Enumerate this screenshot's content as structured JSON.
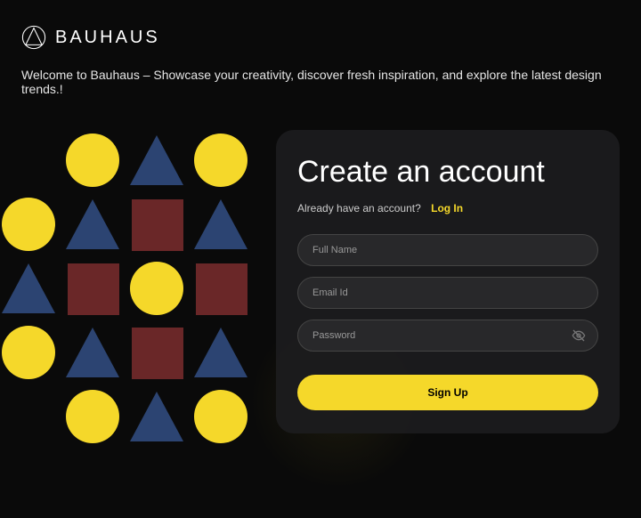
{
  "brand": "BAUHAUS",
  "welcome": "Welcome to Bauhaus – Showcase your creativity, discover fresh inspiration, and explore the latest design trends.!",
  "card": {
    "title": "Create an account",
    "subtitle": "Already have an account?",
    "login_link": "Log In",
    "fields": {
      "fullname_placeholder": "Full Name",
      "email_placeholder": "Email Id",
      "password_placeholder": "Password"
    },
    "signup_label": "Sign Up"
  },
  "colors": {
    "accent": "#f5d82a",
    "triangle": "#2c4472",
    "square": "#6a2728"
  }
}
